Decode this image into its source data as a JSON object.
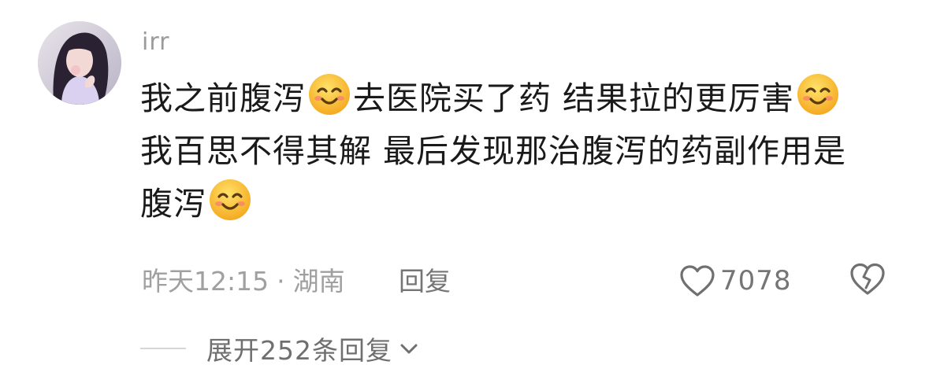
{
  "comment": {
    "username": "irr",
    "lines": [
      {
        "parts": [
          "我之前腹泻",
          "去医院买了药 结果拉的更厉害"
        ]
      },
      {
        "text": "我百思不得其解 最后发现那治腹泻的药副作用是"
      },
      {
        "parts": [
          "腹泻"
        ]
      }
    ],
    "emoji_icon": "smiling-face-emoji",
    "timestamp": "昨天12:15",
    "separator": "·",
    "location": "湖南",
    "reply_label": "回复",
    "like_count": "7078",
    "expand_label": "展开252条回复"
  },
  "colors": {
    "text": "#1a1a1a",
    "meta": "#a0a0a0",
    "action": "#757575",
    "emoji_face": "#f7b52c"
  }
}
